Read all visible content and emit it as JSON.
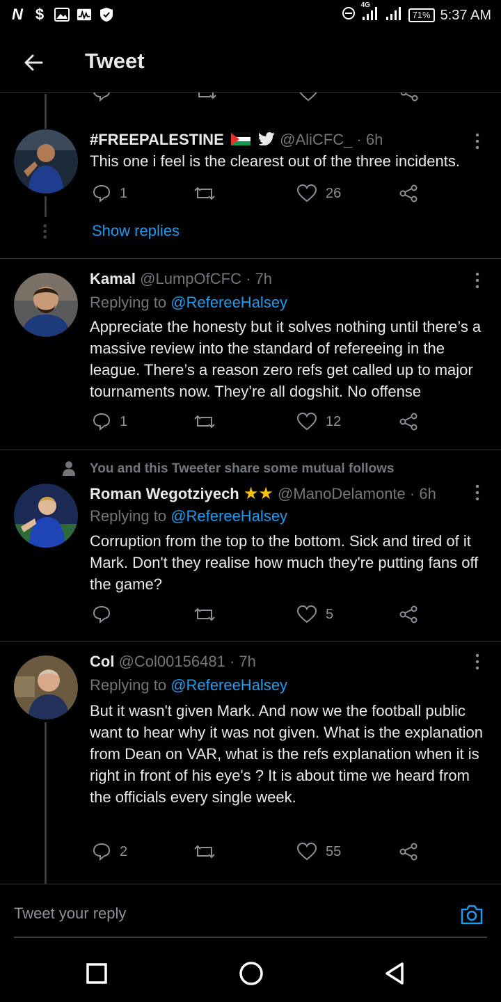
{
  "status_bar": {
    "time": "5:37 AM",
    "battery": "71%",
    "network": "4G"
  },
  "header": {
    "title": "Tweet"
  },
  "tweets": [
    {
      "name": "#FREEPALESTINE",
      "handle": "@AliCFC_",
      "time": "· 6h",
      "text": "This one i feel is the clearest out of the three incidents.",
      "replies": "1",
      "likes": "26",
      "show_replies": "Show replies"
    },
    {
      "name": "Kamal",
      "handle": "@LumpOfCFC",
      "time": "· 7h",
      "replying_label": "Replying to",
      "replying_to": "@RefereeHalsey",
      "text": "Appreciate the honesty but it solves nothing until there’s a massive review into the standard of refereeing in the league. There’s a reason zero refs get called up to major tournaments now. They’re all dogshit. No offense",
      "replies": "1",
      "likes": "12"
    },
    {
      "social_context": "You and this Tweeter share some mutual follows",
      "name": "Roman Wegotziyech",
      "handle": "@ManoDelamonte",
      "time": "· 6h",
      "replying_label": "Replying to",
      "replying_to": "@RefereeHalsey",
      "text": "Corruption from the top to the bottom. Sick and tired of it Mark. Don't they realise how much they're putting fans off the game?",
      "likes": "5"
    },
    {
      "name": "Col",
      "handle": "@Col00156481",
      "time": "· 7h",
      "replying_label": "Replying to",
      "replying_to": "@RefereeHalsey",
      "text": "But it wasn't given Mark. And now we the football public want to hear why it was not given. What is the explanation from Dean on VAR, what is the refs explanation when it is right in front of his eye's ? It is about time we heard from the officials every single week.",
      "replies": "2",
      "likes": "55"
    }
  ],
  "reply_bar": {
    "placeholder": "Tweet your reply"
  },
  "colors": {
    "accent": "#1d9bf0",
    "background": "#000000",
    "muted": "#71767b"
  }
}
